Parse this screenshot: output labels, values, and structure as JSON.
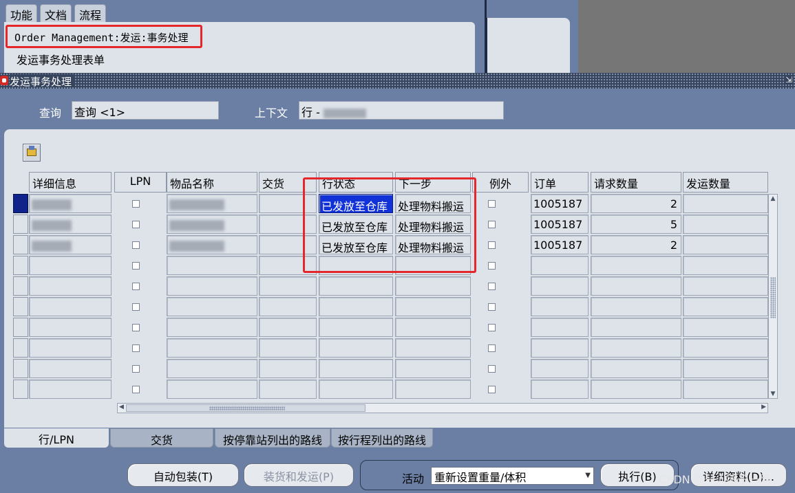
{
  "navigator": {
    "tabs": [
      "功能",
      "文档",
      "流程"
    ],
    "function_item": "Order Management:发运:事务处理",
    "function_item2": "发运事务处理表单"
  },
  "window": {
    "title": "发运事务处理",
    "query_label": "查询",
    "query_value": "查询 <1>",
    "context_label": "上下文",
    "context_value": "行 -"
  },
  "table": {
    "headers": [
      "详细信息",
      "LPN",
      "物品名称",
      "交货",
      "行状态",
      "下一步",
      "例外",
      "订单",
      "请求数量",
      "发运数量"
    ],
    "rows": [
      {
        "status": "已发放至仓库",
        "next": "处理物料搬运",
        "order": "1005187",
        "qty": "2"
      },
      {
        "status": "已发放至仓库",
        "next": "处理物料搬运",
        "order": "1005187",
        "qty": "5"
      },
      {
        "status": "已发放至仓库",
        "next": "处理物料搬运",
        "order": "1005187",
        "qty": "2"
      }
    ]
  },
  "tabs": [
    "行/LPN",
    "交货",
    "按停靠站列出的路线",
    "按行程列出的路线"
  ],
  "buttons": {
    "auto_pack": "自动包装(T)",
    "load_ship": "装货和发运(P)",
    "activity_label": "活动",
    "activity_value": "重新设置重量/体积",
    "execute": "执行(B)",
    "detail": "详细资料(D)..."
  },
  "watermark": "CSDN @一人困于一隅",
  "colors": {
    "highlight": "#1132d6",
    "annotation": "#e5262b",
    "title_bar": "#36445e"
  }
}
